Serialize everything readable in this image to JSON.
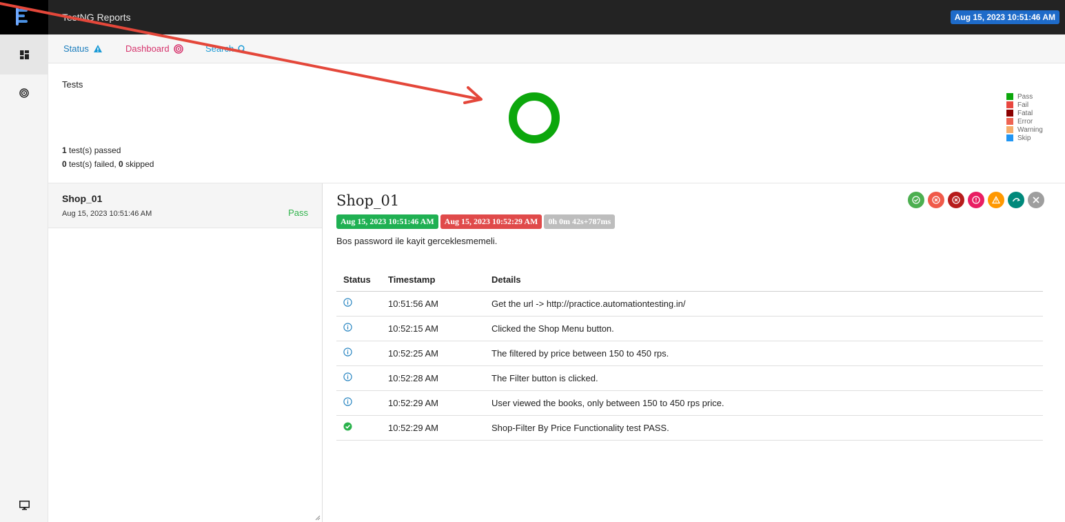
{
  "app": {
    "title": "TestNG Reports",
    "date_badge": "Aug 15, 2023 10:51:46 AM"
  },
  "subnav": {
    "status": "Status",
    "dashboard": "Dashboard",
    "search": "Search"
  },
  "summary": {
    "heading": "Tests",
    "passed_count": "1",
    "passed_text": " test(s) passed",
    "failed_count": "0",
    "failed_text": " test(s) failed, ",
    "skipped_count": "0",
    "skipped_text": " skipped"
  },
  "chart_data": {
    "type": "pie",
    "variant": "doughnut",
    "categories": [
      "Pass",
      "Fail",
      "Fatal",
      "Error",
      "Warning",
      "Skip"
    ],
    "values": [
      1,
      0,
      0,
      0,
      0,
      0
    ],
    "colors": [
      "#0ca70c",
      "#e8473f",
      "#8b0000",
      "#ee6352",
      "#f5ad6b",
      "#2196f3"
    ],
    "legend": "right"
  },
  "test_list": [
    {
      "name": "Shop_01",
      "time": "Aug 15, 2023 10:51:46 AM",
      "status": "Pass"
    }
  ],
  "detail": {
    "title": "Shop_01",
    "start": "Aug 15, 2023 10:51:46 AM",
    "end": "Aug 15, 2023 10:52:29 AM",
    "duration": "0h 0m 42s+787ms",
    "description": "Bos password ile kayit gerceklesmemeli.",
    "columns": {
      "status": "Status",
      "timestamp": "Timestamp",
      "details": "Details"
    },
    "logs": [
      {
        "status": "info",
        "timestamp": "10:51:56 AM",
        "details": "Get the url -> http://practice.automationtesting.in/"
      },
      {
        "status": "info",
        "timestamp": "10:52:15 AM",
        "details": "Clicked the Shop Menu button."
      },
      {
        "status": "info",
        "timestamp": "10:52:25 AM",
        "details": "The filtered by price between 150 to 450 rps."
      },
      {
        "status": "info",
        "timestamp": "10:52:28 AM",
        "details": "The Filter button is clicked."
      },
      {
        "status": "info",
        "timestamp": "10:52:29 AM",
        "details": "User viewed the books, only between 150 to 450 rps price."
      },
      {
        "status": "pass",
        "timestamp": "10:52:29 AM",
        "details": "Shop-Filter By Price Functionality test PASS."
      }
    ],
    "filter_icons": [
      "pass-filter-icon",
      "fail-filter-icon",
      "fatal-filter-icon",
      "error-filter-icon",
      "warning-filter-icon",
      "skip-filter-icon",
      "clear-filter-icon"
    ]
  }
}
